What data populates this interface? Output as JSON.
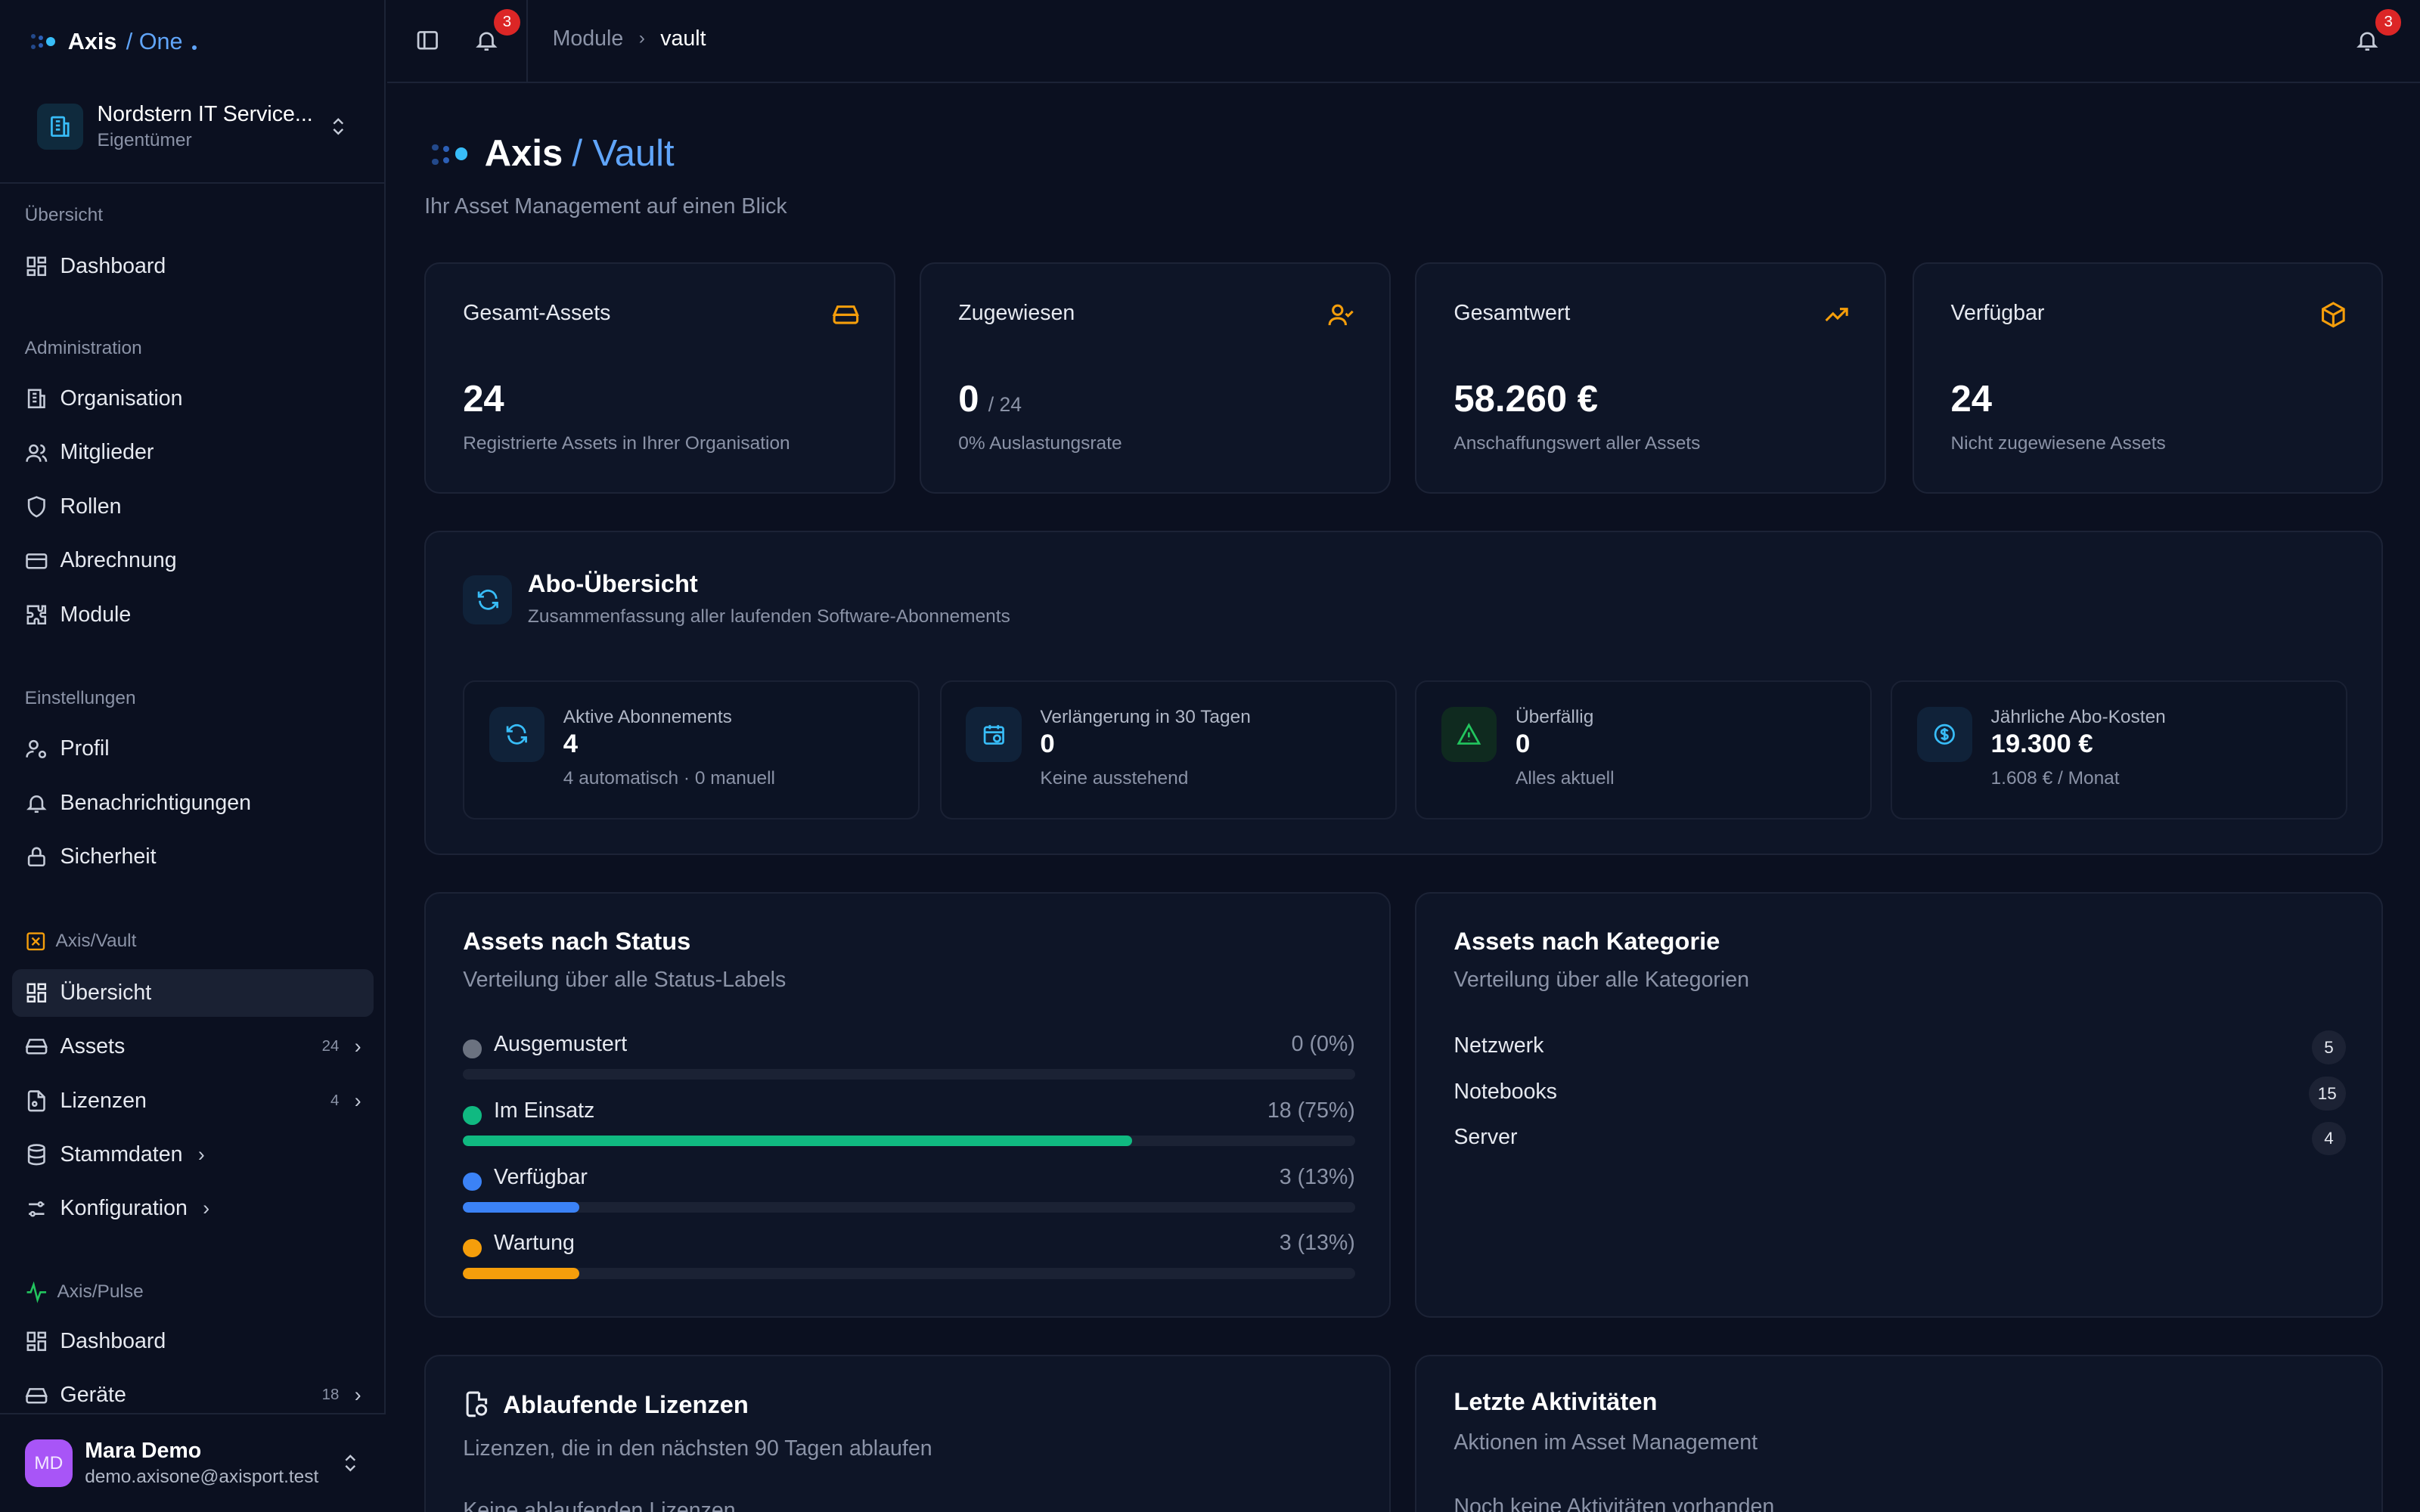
{
  "brand": {
    "name": "Axis",
    "sub": "/ One"
  },
  "org": {
    "name": "Nordstern IT Service...",
    "role": "Eigentümer"
  },
  "nav": {
    "overview_label": "Übersicht",
    "dashboard": "Dashboard",
    "admin_label": "Administration",
    "admin_items": [
      "Organisation",
      "Mitglieder",
      "Rollen",
      "Abrechnung",
      "Module"
    ],
    "settings_label": "Einstellungen",
    "settings_items": [
      "Profil",
      "Benachrichtigungen",
      "Sicherheit"
    ],
    "vault_label": "Axis/Vault",
    "vault_items": [
      {
        "label": "Übersicht",
        "count": ""
      },
      {
        "label": "Assets",
        "count": "24"
      },
      {
        "label": "Lizenzen",
        "count": "4"
      },
      {
        "label": "Stammdaten",
        "count": ""
      },
      {
        "label": "Konfiguration",
        "count": ""
      }
    ],
    "pulse_label": "Axis/Pulse",
    "pulse_items": [
      {
        "label": "Dashboard",
        "count": ""
      },
      {
        "label": "Geräte",
        "count": "18"
      }
    ]
  },
  "user": {
    "initials": "MD",
    "name": "Mara Demo",
    "email": "demo.axisone@axisport.test"
  },
  "topbar": {
    "notif_count": "3",
    "breadcrumb": [
      "Module",
      "vault"
    ]
  },
  "page": {
    "title_a": "Axis",
    "title_b": "/ Vault",
    "subtitle": "Ihr Asset Management auf einen Blick"
  },
  "stats": [
    {
      "title": "Gesamt-Assets",
      "value": "24",
      "of": "",
      "desc": "Registrierte Assets in Ihrer Organisation",
      "icon": "storage-icon"
    },
    {
      "title": "Zugewiesen",
      "value": "0",
      "of": "/ 24",
      "desc": "0% Auslastungsrate",
      "icon": "user-check-icon"
    },
    {
      "title": "Gesamtwert",
      "value": "58.260 €",
      "of": "",
      "desc": "Anschaffungswert aller Assets",
      "icon": "trend-up-icon"
    },
    {
      "title": "Verfügbar",
      "value": "24",
      "of": "",
      "desc": "Nicht zugewiesene Assets",
      "icon": "box-icon"
    }
  ],
  "abo": {
    "title": "Abo-Übersicht",
    "subtitle": "Zusammenfassung aller laufenden Software-Abonnements",
    "tiles": [
      {
        "label": "Aktive Abonnements",
        "value": "4",
        "sub": "4 automatisch · 0 manuell"
      },
      {
        "label": "Verlängerung in 30 Tagen",
        "value": "0",
        "sub": "Keine ausstehend"
      },
      {
        "label": "Überfällig",
        "value": "0",
        "sub": "Alles aktuell"
      },
      {
        "label": "Jährliche Abo-Kosten",
        "value": "19.300 €",
        "sub": "1.608 € / Monat"
      }
    ]
  },
  "status": {
    "title": "Assets nach Status",
    "subtitle": "Verteilung über alle Status-Labels",
    "rows": [
      {
        "label": "Ausgemustert",
        "value": "0 (0%)",
        "fraction": 0,
        "color": "#6b7280"
      },
      {
        "label": "Im Einsatz",
        "value": "18 (75%)",
        "fraction": 0.75,
        "color": "#10b981"
      },
      {
        "label": "Verfügbar",
        "value": "3 (13%)",
        "fraction": 0.13,
        "color": "#3b82f6"
      },
      {
        "label": "Wartung",
        "value": "3 (13%)",
        "fraction": 0.13,
        "color": "#f59e0b"
      }
    ]
  },
  "category": {
    "title": "Assets nach Kategorie",
    "subtitle": "Verteilung über alle Kategorien",
    "rows": [
      {
        "label": "Netzwerk",
        "count": "5"
      },
      {
        "label": "Notebooks",
        "count": "15"
      },
      {
        "label": "Server",
        "count": "4"
      }
    ]
  },
  "licenses": {
    "title": "Ablaufende Lizenzen",
    "subtitle": "Lizenzen, die in den nächsten 90 Tagen ablaufen",
    "empty": "Keine ablaufenden Lizenzen"
  },
  "activity": {
    "title": "Letzte Aktivitäten",
    "subtitle": "Aktionen im Asset Management",
    "empty": "Noch keine Aktivitäten vorhanden"
  },
  "colors": {
    "accent": "#60a5fa",
    "amber": "#f59e0b",
    "badge": "#dc2626"
  }
}
